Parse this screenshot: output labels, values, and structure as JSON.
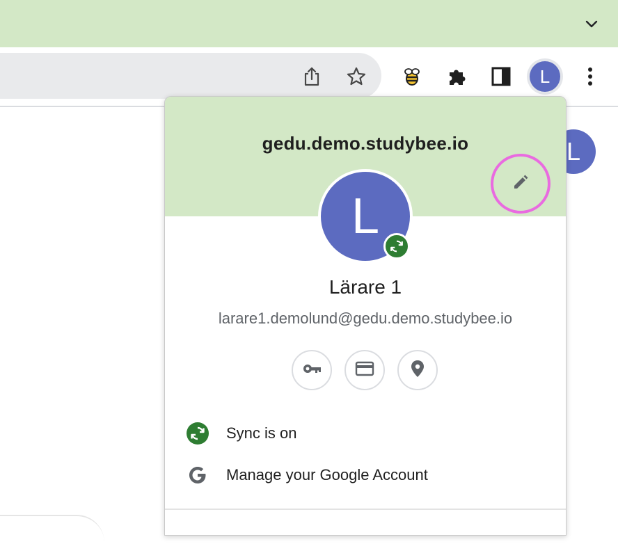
{
  "browser": {
    "tab_dropdown_icon": "chevron-down-icon",
    "toolbar_icons": [
      "share-icon",
      "bookmark-star-icon",
      "studybee-extension-icon",
      "extensions-puzzle-icon",
      "side-panel-icon",
      "profile-avatar",
      "more-menu-icon"
    ],
    "profile_initial": "L",
    "page_avatar_initial": "L"
  },
  "profile_popup": {
    "domain_title": "gedu.demo.studybee.io",
    "avatar_initial": "L",
    "user_name": "Lärare 1",
    "user_email": "larare1.demolund@gedu.demo.studybee.io",
    "quick_actions": [
      "password-key-icon",
      "payment-card-icon",
      "address-pin-icon"
    ],
    "menu": [
      {
        "label": "Sync is on",
        "icon": "sync-icon"
      },
      {
        "label": "Manage your Google Account",
        "icon": "google-g-icon"
      }
    ]
  },
  "colors": {
    "header_green": "#d3e8c6",
    "avatar_blue": "#5c6bc0",
    "sync_green": "#2e7d32",
    "highlight_ring": "#e96be0"
  }
}
